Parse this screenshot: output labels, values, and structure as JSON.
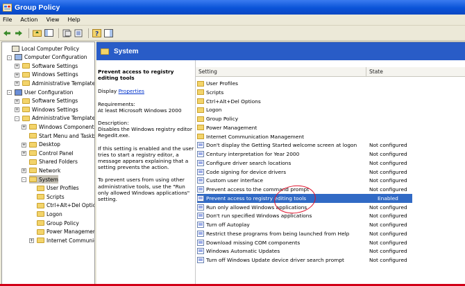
{
  "window": {
    "title": "Group Policy"
  },
  "menu": [
    "File",
    "Action",
    "View",
    "Help"
  ],
  "tree": [
    {
      "label": "Local Computer Policy",
      "level": 0,
      "pm": "",
      "icon": "policy"
    },
    {
      "label": "Computer Configuration",
      "level": 1,
      "pm": "-",
      "icon": "computer"
    },
    {
      "label": "Software Settings",
      "level": 2,
      "pm": "+",
      "icon": "folder"
    },
    {
      "label": "Windows Settings",
      "level": 2,
      "pm": "+",
      "icon": "folder"
    },
    {
      "label": "Administrative Templates",
      "level": 2,
      "pm": "+",
      "icon": "folder"
    },
    {
      "label": "User Configuration",
      "level": 1,
      "pm": "-",
      "icon": "user"
    },
    {
      "label": "Software Settings",
      "level": 2,
      "pm": "+",
      "icon": "folder"
    },
    {
      "label": "Windows Settings",
      "level": 2,
      "pm": "+",
      "icon": "folder"
    },
    {
      "label": "Administrative Templates",
      "level": 2,
      "pm": "-",
      "icon": "folder"
    },
    {
      "label": "Windows Components",
      "level": 3,
      "pm": "+",
      "icon": "folder"
    },
    {
      "label": "Start Menu and Taskba",
      "level": 3,
      "pm": "",
      "icon": "folder"
    },
    {
      "label": "Desktop",
      "level": 3,
      "pm": "+",
      "icon": "folder"
    },
    {
      "label": "Control Panel",
      "level": 3,
      "pm": "+",
      "icon": "folder"
    },
    {
      "label": "Shared Folders",
      "level": 3,
      "pm": "",
      "icon": "folder"
    },
    {
      "label": "Network",
      "level": 3,
      "pm": "+",
      "icon": "folder"
    },
    {
      "label": "System",
      "level": 3,
      "pm": "-",
      "icon": "folder",
      "selected": true
    },
    {
      "label": "User Profiles",
      "level": 4,
      "pm": "",
      "icon": "folder"
    },
    {
      "label": "Scripts",
      "level": 4,
      "pm": "",
      "icon": "folder"
    },
    {
      "label": "Ctrl+Alt+Del Optio",
      "level": 4,
      "pm": "",
      "icon": "folder"
    },
    {
      "label": "Logon",
      "level": 4,
      "pm": "",
      "icon": "folder"
    },
    {
      "label": "Group Policy",
      "level": 4,
      "pm": "",
      "icon": "folder"
    },
    {
      "label": "Power Managemen",
      "level": 4,
      "pm": "",
      "icon": "folder"
    },
    {
      "label": "Internet Communic",
      "level": 4,
      "pm": "+",
      "icon": "folder"
    }
  ],
  "panel": {
    "title": "System",
    "description": {
      "heading": "Prevent access to registry editing tools",
      "display_prefix": "Display",
      "display_link": "Properties",
      "requirements": "Requirements:\nAt least Microsoft Windows 2000",
      "desc": "Description:\nDisables the Windows registry editor Regedit.exe.",
      "p2": "If this setting is enabled and the user tries to start a registry editor, a message appears explaining that a setting prevents the action.",
      "p3": "To prevent users from using other administrative tools, use the \"Run only allowed Windows applications\" setting."
    },
    "columns": {
      "setting": "Setting",
      "state": "State"
    },
    "rows": [
      {
        "name": "User Profiles",
        "state": "",
        "type": "folder"
      },
      {
        "name": "Scripts",
        "state": "",
        "type": "folder"
      },
      {
        "name": "Ctrl+Alt+Del Options",
        "state": "",
        "type": "folder"
      },
      {
        "name": "Logon",
        "state": "",
        "type": "folder"
      },
      {
        "name": "Group Policy",
        "state": "",
        "type": "folder"
      },
      {
        "name": "Power Management",
        "state": "",
        "type": "folder"
      },
      {
        "name": "Internet Communication Management",
        "state": "",
        "type": "folder"
      },
      {
        "name": "Don't display the Getting Started welcome screen at logon",
        "state": "Not configured",
        "type": "setting"
      },
      {
        "name": "Century interpretation for Year 2000",
        "state": "Not configured",
        "type": "setting"
      },
      {
        "name": "Configure driver search locations",
        "state": "Not configured",
        "type": "setting"
      },
      {
        "name": "Code signing for device drivers",
        "state": "Not configured",
        "type": "setting"
      },
      {
        "name": "Custom user interface",
        "state": "Not configured",
        "type": "setting"
      },
      {
        "name": "Prevent access to the command prompt",
        "state": "Not configured",
        "type": "setting"
      },
      {
        "name": "Prevent access to registry editing tools",
        "state": "Enabled",
        "type": "setting",
        "selected": true
      },
      {
        "name": "Run only allowed Windows applications",
        "state": "Not configured",
        "type": "setting"
      },
      {
        "name": "Don't run specified Windows applications",
        "state": "Not configured",
        "type": "setting"
      },
      {
        "name": "Turn off Autoplay",
        "state": "Not configured",
        "type": "setting"
      },
      {
        "name": "Restrict these programs from being launched from Help",
        "state": "Not configured",
        "type": "setting"
      },
      {
        "name": "Download missing COM components",
        "state": "Not configured",
        "type": "setting"
      },
      {
        "name": "Windows Automatic Updates",
        "state": "Not configured",
        "type": "setting"
      },
      {
        "name": "Turn off Windows Update device driver search prompt",
        "state": "Not configured",
        "type": "setting"
      }
    ]
  },
  "colors": {
    "title_bar": "#0a53d8",
    "header": "#295cc7",
    "selection": "#316ac5",
    "annotation": "#e0102a"
  }
}
